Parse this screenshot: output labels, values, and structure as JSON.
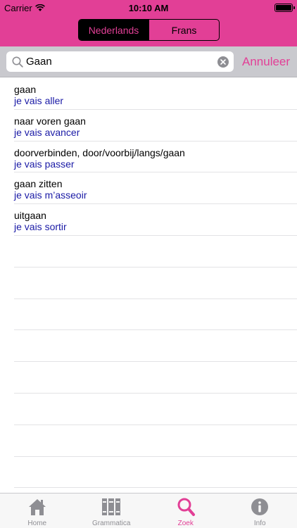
{
  "status_bar": {
    "carrier": "Carrier",
    "time": "10:10 AM"
  },
  "segmented_control": {
    "options": [
      "Nederlands",
      "Frans"
    ],
    "selected": "Nederlands"
  },
  "search": {
    "value": "Gaan",
    "cancel_label": "Annuleer"
  },
  "results": [
    {
      "dutch": "gaan",
      "french": "je vais aller"
    },
    {
      "dutch": "naar voren gaan",
      "french": "je vais avancer"
    },
    {
      "dutch": "doorverbinden, door/voorbij/langs/gaan",
      "french": "je vais passer"
    },
    {
      "dutch": "gaan zitten",
      "french": "je vais m’asseoir"
    },
    {
      "dutch": "uitgaan",
      "french": "je vais sortir"
    }
  ],
  "tab_bar": {
    "tabs": [
      {
        "label": "Home",
        "icon": "home-icon"
      },
      {
        "label": "Grammatica",
        "icon": "books-icon"
      },
      {
        "label": "Zoek",
        "icon": "search-icon"
      },
      {
        "label": "Info",
        "icon": "info-icon"
      }
    ],
    "active": "Zoek"
  },
  "colors": {
    "accent": "#e23f96",
    "translation_text": "#1a1aa6",
    "tab_inactive": "#8e8e93"
  }
}
